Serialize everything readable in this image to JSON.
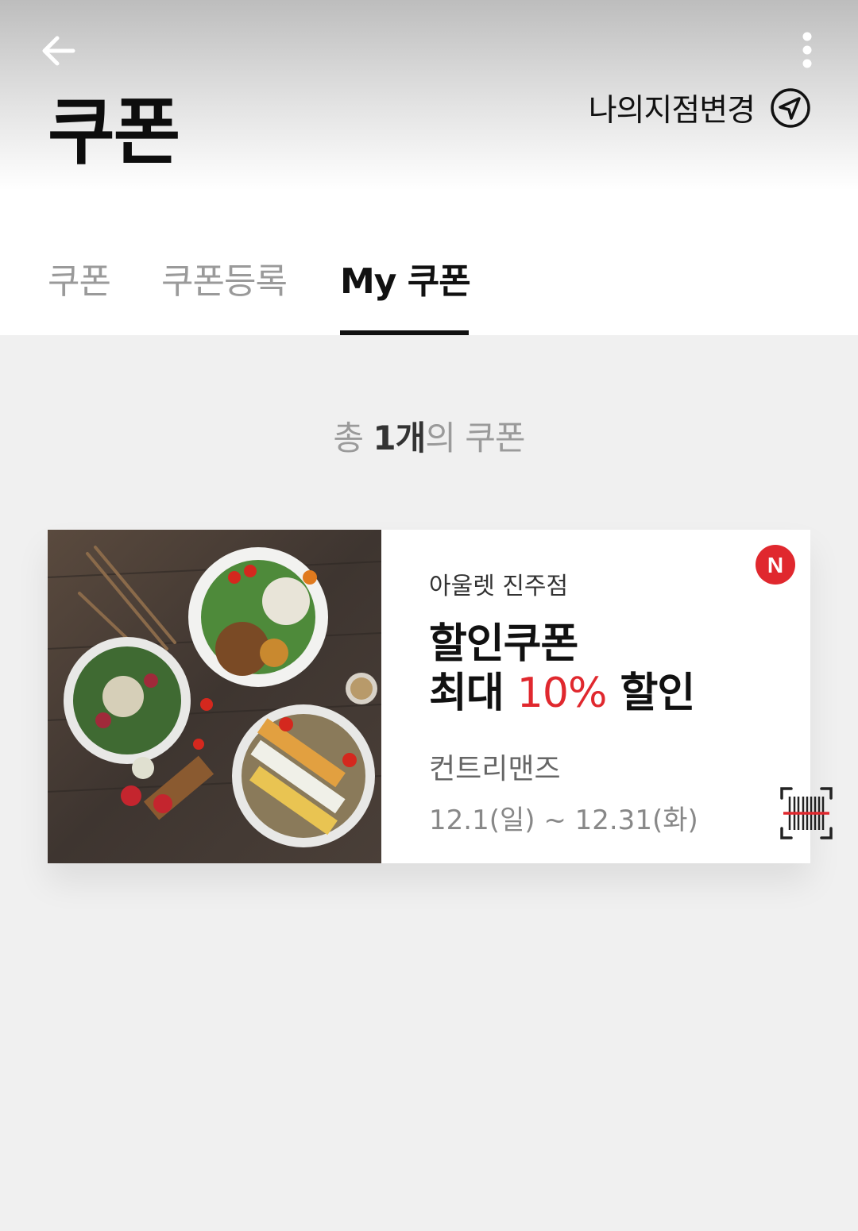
{
  "header": {
    "title": "쿠폰",
    "branch_change_label": "나의지점변경",
    "icons": {
      "back": "arrow-left-icon",
      "more": "more-vertical-icon",
      "location": "navigation-icon"
    }
  },
  "tabs": [
    {
      "label": "쿠폰",
      "active": false
    },
    {
      "label": "쿠폰등록",
      "active": false
    },
    {
      "label": "My 쿠폰",
      "active": true
    }
  ],
  "summary": {
    "prefix": "총",
    "count": "1개",
    "suffix": "의 쿠폰"
  },
  "coupon": {
    "image_alt": "salad and steak food photo",
    "branch": "아울렛 진주점",
    "new_badge": "N",
    "title": "할인쿠폰",
    "discount_prefix": "최대",
    "discount_value": "10%",
    "discount_suffix": "할인",
    "brand": "컨트리맨즈",
    "period": "12.1(일) ~ 12.31(화)",
    "barcode_icon": "barcode-scan-icon"
  },
  "colors": {
    "accent_red": "#e0282e",
    "tab_inactive": "#9a9a9a",
    "text_primary": "#111111",
    "background": "#f0f0f0"
  }
}
